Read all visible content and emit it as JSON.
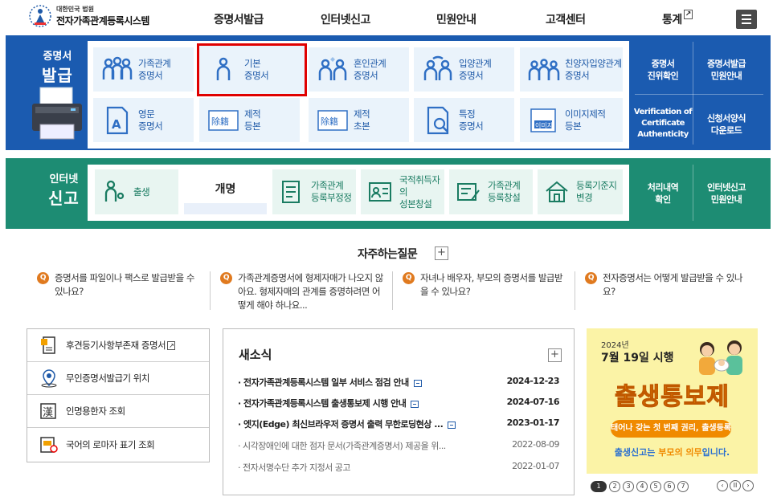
{
  "header": {
    "logo_sub": "대한민국 법원",
    "logo_main": "전자가족관계등록시스템",
    "nav": [
      {
        "label": "증명서발급"
      },
      {
        "label": "인터넷신고"
      },
      {
        "label": "민원안내"
      },
      {
        "label": "고객센터"
      },
      {
        "label": "통계"
      }
    ],
    "external_mark": "↗"
  },
  "certificate": {
    "title_top": "증명서",
    "title_bottom": "발급",
    "tiles": [
      {
        "line1": "가족관계",
        "line2": "증명서",
        "icon": "family-icon"
      },
      {
        "line1": "기본",
        "line2": "증명서",
        "icon": "person-icon",
        "selected": true
      },
      {
        "line1": "혼인관계",
        "line2": "증명서",
        "icon": "couple-icon"
      },
      {
        "line1": "입양관계",
        "line2": "증명서",
        "icon": "adoption-icon"
      },
      {
        "line1": "친양자입양관계",
        "line2": "증명서",
        "icon": "family-adoption-icon"
      },
      {
        "line1": "영문",
        "line2": "증명서",
        "icon": "english-doc-icon"
      },
      {
        "line1": "제적",
        "line2": "등본",
        "icon": "removed-register-icon"
      },
      {
        "line1": "제적",
        "line2": "초본",
        "icon": "removed-register-icon"
      },
      {
        "line1": "특정",
        "line2": "증명서",
        "icon": "search-doc-icon"
      },
      {
        "line1": "이미지제적",
        "line2": "등본",
        "icon": "image-register-icon"
      }
    ],
    "side_links": [
      {
        "line1": "증명서",
        "line2": "진위확인"
      },
      {
        "line1": "증명서발급",
        "line2": "민원안내"
      },
      {
        "line1": "Verification of",
        "line2": "Certificate",
        "line3": "Authenticity"
      },
      {
        "line1": "신청서양식",
        "line2": "다운로드"
      }
    ]
  },
  "online": {
    "title_top": "인터넷",
    "title_bottom": "신고",
    "tiles": [
      {
        "line1": "출생",
        "line2": ""
      },
      {
        "line1": "개명",
        "line2": ""
      },
      {
        "line1": "가족관계",
        "line2": "등록부정정"
      },
      {
        "line1": "국적취득자의",
        "line2": "성본창설"
      },
      {
        "line1": "가족관계",
        "line2": "등록창설"
      },
      {
        "line1": "등록기준지",
        "line2": "변경"
      }
    ],
    "side_links": [
      {
        "line1": "처리내역",
        "line2": "확인"
      },
      {
        "line1": "인터넷신고",
        "line2": "민원안내"
      }
    ]
  },
  "faq": {
    "title": "자주하는질문",
    "plus": "+",
    "q_mark": "Q",
    "items": [
      {
        "text": "증명서를 파일이나 팩스로 발급받을 수 있나요?"
      },
      {
        "text": "가족관계증명서에 형제자매가 나오지 않아요. 형제자매의 관계를 증명하려면 어떻게 해야 하나요..."
      },
      {
        "text": "자녀나 배우자, 부모의 증명서를 발급받을 수 있나요?"
      },
      {
        "text": "전자증명서는 어떻게 발급받을 수 있나요?"
      }
    ]
  },
  "quick_links": [
    {
      "label": "후견등기사항부존재 증명서",
      "external": "↗"
    },
    {
      "label": "무인증명서발급기 위치"
    },
    {
      "label": "인명용한자 조회"
    },
    {
      "label": "국어의 로마자 표기 조회"
    }
  ],
  "news": {
    "title": "새소식",
    "plus": "+",
    "items": [
      {
        "text": "· 전자가족관계등록시스템 일부 서비스 점검 안내",
        "date": "2024-12-23",
        "new": true
      },
      {
        "text": "· 전자가족관계등록시스템 출생통보제 시행 안내",
        "date": "2024-07-16",
        "new": true
      },
      {
        "text": "· 엣지(Edge) 최신브라우저 증명서 출력 무한로딩현상 ...",
        "date": "2023-01-17",
        "new": true
      },
      {
        "text": "· 시각장애인에 대한 점자 문서(가족관계증명서) 제공을 위...",
        "date": "2022-08-09",
        "new": false
      },
      {
        "text": "· 전자서명수단 추가 지정서 공고",
        "date": "2022-01-07",
        "new": false
      }
    ]
  },
  "banner": {
    "year": "2024년",
    "date": "7월 19일 시행",
    "main": "출생통보제",
    "pill": "태어나 갖는 첫 번째 권리, 출생등록",
    "foot_pre": "출생신고는 ",
    "foot_hl": "부모의 의무",
    "foot_post": "입니다.",
    "pages": [
      "1",
      "2",
      "3",
      "4",
      "5",
      "6",
      "7"
    ],
    "controls": [
      "‹",
      "II",
      "›"
    ]
  },
  "colors": {
    "cert_blue": "#1b5bb0",
    "online_green": "#1d8c73",
    "selected_outline": "#e00000",
    "faq_q": "#e07a1f",
    "banner_yellow": "#fbf3a6"
  }
}
